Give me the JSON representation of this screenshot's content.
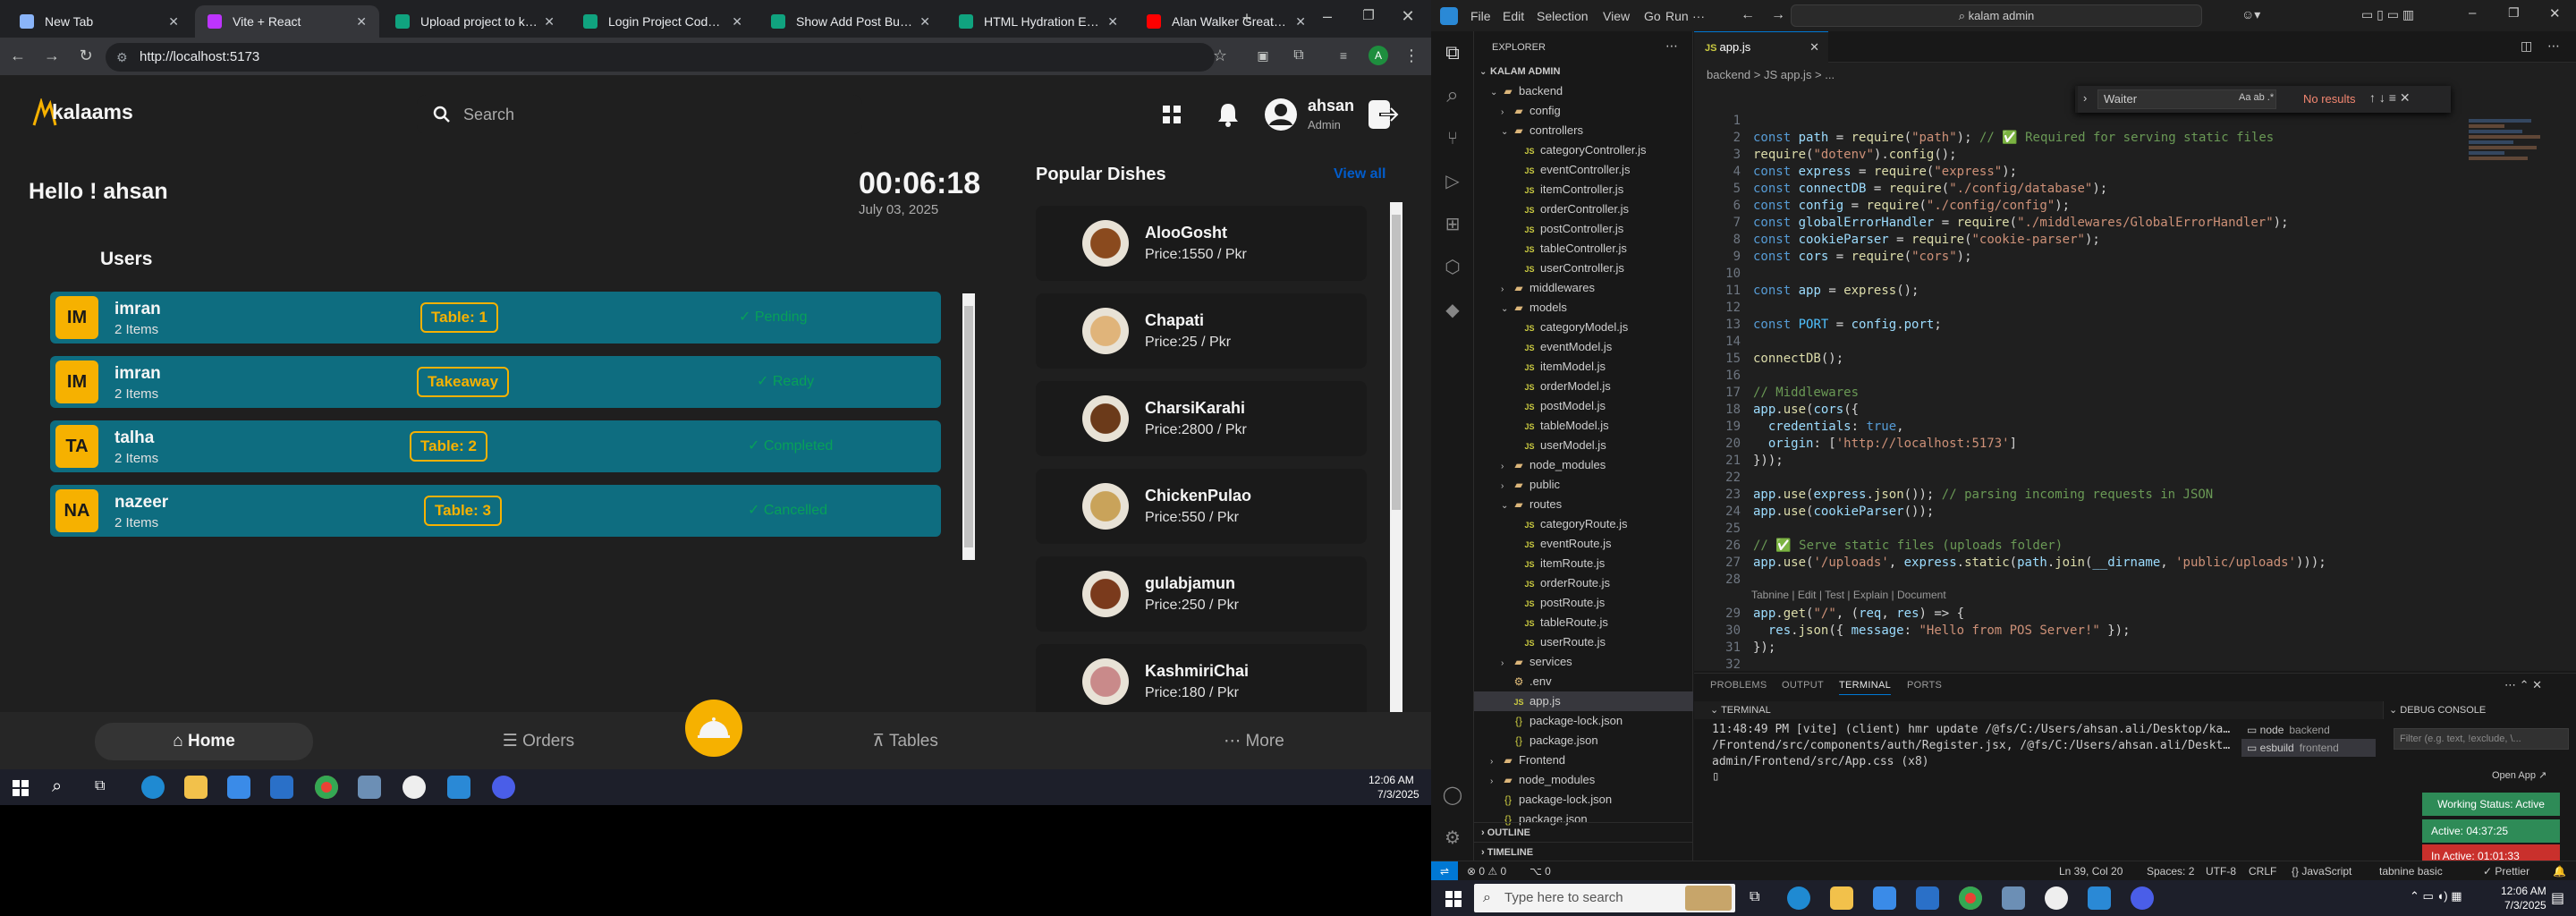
{
  "browser": {
    "tabs": [
      {
        "title": "New Tab",
        "color": "#8ab4f8",
        "active": false
      },
      {
        "title": "Vite + React",
        "color": "#bd34fe",
        "active": true
      },
      {
        "title": "Upload project to kala",
        "color": "#10a37f",
        "active": false
      },
      {
        "title": "Login Project Code He",
        "color": "#10a37f",
        "active": false
      },
      {
        "title": "Show Add Post Button",
        "color": "#10a37f",
        "active": false
      },
      {
        "title": "HTML Hydration Error",
        "color": "#10a37f",
        "active": false
      },
      {
        "title": "Alan Walker Greatest",
        "color": "#ff0000",
        "active": false
      }
    ],
    "url": "http://localhost:5173",
    "profile_initial": "A"
  },
  "pos": {
    "brand": "kalaams",
    "search_placeholder": "Search",
    "user_name": "ahsan",
    "user_role": "Admin",
    "greeting": "Hello ! ahsan",
    "clock": "00:06:18",
    "date": "July 03, 2025",
    "users_heading": "Users",
    "orders": [
      {
        "initials": "IM",
        "name": "imran",
        "items": "2 Items",
        "table": "Table: 1",
        "status": "Pending"
      },
      {
        "initials": "IM",
        "name": "imran",
        "items": "2 Items",
        "table": "Takeaway",
        "status": "Ready"
      },
      {
        "initials": "TA",
        "name": "talha",
        "items": "2 Items",
        "table": "Table: 2",
        "status": "Completed"
      },
      {
        "initials": "NA",
        "name": "nazeer",
        "items": "2 Items",
        "table": "Table: 3",
        "status": "Cancelled"
      }
    ],
    "popular_heading": "Popular Dishes",
    "view_all": "View all",
    "dishes": [
      {
        "name": "AlooGosht",
        "price": "Price:1550 / Pkr",
        "color": "#8a4a1e"
      },
      {
        "name": "Chapati",
        "price": "Price:25 / Pkr",
        "color": "#e0b47a"
      },
      {
        "name": "CharsiKarahi",
        "price": "Price:2800 / Pkr",
        "color": "#6b3a1a"
      },
      {
        "name": "ChickenPulao",
        "price": "Price:550 / Pkr",
        "color": "#c9a35a"
      },
      {
        "name": "gulabjamun",
        "price": "Price:250 / Pkr",
        "color": "#7a3a1c"
      },
      {
        "name": "KashmiriChai",
        "price": "Price:180 / Pkr",
        "color": "#c98a8a"
      }
    ],
    "nav": {
      "home": "Home",
      "orders": "Orders",
      "tables": "Tables",
      "more": "More"
    }
  },
  "left_taskbar": {
    "time": "12:06 AM",
    "date": "7/3/2025"
  },
  "vscode": {
    "menu": [
      "File",
      "Edit",
      "Selection",
      "View",
      "Go",
      "Run",
      "···"
    ],
    "command_center": "kalam admin",
    "explorer_title": "EXPLORER",
    "tree": [
      {
        "label": "KALAM ADMIN",
        "indent": 0,
        "kind": "root",
        "open": true
      },
      {
        "label": "backend",
        "indent": 1,
        "kind": "folder",
        "open": true
      },
      {
        "label": "config",
        "indent": 2,
        "kind": "folder",
        "open": false
      },
      {
        "label": "controllers",
        "indent": 2,
        "kind": "folder",
        "open": true
      },
      {
        "label": "categoryController.js",
        "indent": 3,
        "kind": "js"
      },
      {
        "label": "eventController.js",
        "indent": 3,
        "kind": "js"
      },
      {
        "label": "itemController.js",
        "indent": 3,
        "kind": "js"
      },
      {
        "label": "orderController.js",
        "indent": 3,
        "kind": "js"
      },
      {
        "label": "postController.js",
        "indent": 3,
        "kind": "js"
      },
      {
        "label": "tableController.js",
        "indent": 3,
        "kind": "js"
      },
      {
        "label": "userController.js",
        "indent": 3,
        "kind": "js"
      },
      {
        "label": "middlewares",
        "indent": 2,
        "kind": "folder",
        "open": false
      },
      {
        "label": "models",
        "indent": 2,
        "kind": "folder",
        "open": true
      },
      {
        "label": "categoryModel.js",
        "indent": 3,
        "kind": "js"
      },
      {
        "label": "eventModel.js",
        "indent": 3,
        "kind": "js"
      },
      {
        "label": "itemModel.js",
        "indent": 3,
        "kind": "js"
      },
      {
        "label": "orderModel.js",
        "indent": 3,
        "kind": "js"
      },
      {
        "label": "postModel.js",
        "indent": 3,
        "kind": "js"
      },
      {
        "label": "tableModel.js",
        "indent": 3,
        "kind": "js"
      },
      {
        "label": "userModel.js",
        "indent": 3,
        "kind": "js"
      },
      {
        "label": "node_modules",
        "indent": 2,
        "kind": "folder",
        "open": false
      },
      {
        "label": "public",
        "indent": 2,
        "kind": "folder",
        "open": false
      },
      {
        "label": "routes",
        "indent": 2,
        "kind": "folder",
        "open": true
      },
      {
        "label": "categoryRoute.js",
        "indent": 3,
        "kind": "js"
      },
      {
        "label": "eventRoute.js",
        "indent": 3,
        "kind": "js"
      },
      {
        "label": "itemRoute.js",
        "indent": 3,
        "kind": "js"
      },
      {
        "label": "orderRoute.js",
        "indent": 3,
        "kind": "js"
      },
      {
        "label": "postRoute.js",
        "indent": 3,
        "kind": "js"
      },
      {
        "label": "tableRoute.js",
        "indent": 3,
        "kind": "js"
      },
      {
        "label": "userRoute.js",
        "indent": 3,
        "kind": "js"
      },
      {
        "label": "services",
        "indent": 2,
        "kind": "folder",
        "open": false
      },
      {
        "label": ".env",
        "indent": 2,
        "kind": "env"
      },
      {
        "label": "app.js",
        "indent": 2,
        "kind": "js",
        "selected": true
      },
      {
        "label": "package-lock.json",
        "indent": 2,
        "kind": "json"
      },
      {
        "label": "package.json",
        "indent": 2,
        "kind": "json"
      },
      {
        "label": "Frontend",
        "indent": 1,
        "kind": "folder",
        "open": false
      },
      {
        "label": "node_modules",
        "indent": 1,
        "kind": "folder",
        "open": false
      },
      {
        "label": "package-lock.json",
        "indent": 1,
        "kind": "json"
      },
      {
        "label": "package.json",
        "indent": 1,
        "kind": "json"
      }
    ],
    "outline": "OUTLINE",
    "timeline": "TIMELINE",
    "editor_tab": "app.js",
    "breadcrumb": "backend  >  JS app.js  >  ...",
    "find_value": "Waiter",
    "find_result": "No results",
    "codelens": "Tabnine | Edit | Test | Explain | Document",
    "code": [
      "",
      "const path = require(\"path\"); // ✅ Required for serving static files",
      "require(\"dotenv\").config();",
      "const express = require(\"express\");",
      "const connectDB = require(\"./config/database\");",
      "const config = require(\"./config/config\");",
      "const globalErrorHandler = require(\"./middlewares/GlobalErrorHandler\");",
      "const cookieParser = require(\"cookie-parser\");",
      "const cors = require(\"cors\");",
      "",
      "const app = express();",
      "",
      "const PORT = config.port;",
      "",
      "connectDB();",
      "",
      "// Middlewares",
      "app.use(cors({",
      "  credentials: true,",
      "  origin: ['http://localhost:5173']",
      "}));",
      "",
      "app.use(express.json()); // parsing incoming requests in JSON",
      "app.use(cookieParser());",
      "",
      "// ✅ Serve static files (uploads folder)",
      "app.use('/uploads', express.static(path.join(__dirname, 'public/uploads')));",
      "",
      "app.get(\"/\", (req, res) => {",
      "  res.json({ message: \"Hello from POS Server!\" });",
      "});",
      ""
    ],
    "panel_tabs": [
      "PROBLEMS",
      "OUTPUT",
      "TERMINAL",
      "PORTS"
    ],
    "terminal_title": "TERMINAL",
    "terminal_lines": [
      "11:48:49 PM [vite] (client) hmr update /@fs/C:/Users/ahsan.ali/Desktop/kalam admin",
      "/Frontend/src/components/auth/Register.jsx, /@fs/C:/Users/ahsan.ali/Desktop/kalam",
      "admin/Frontend/src/App.css (x8)"
    ],
    "terminals": [
      {
        "name": "node",
        "label": "backend"
      },
      {
        "name": "esbuild",
        "label": "frontend"
      }
    ],
    "debug_title": "DEBUG CONSOLE",
    "debug_filter": "Filter (e.g. text, !exclude, \\...",
    "open_app": "Open App ↗",
    "working_status": "Working Status: Active",
    "active_time": "Active: 04:37:25",
    "inactive_time": "In Active: 01:01:33",
    "status": {
      "errors": "⊗ 0  ⚠ 0",
      "ports": "⌥ 0",
      "position": "Ln 39, Col 20",
      "spaces": "Spaces: 2",
      "encoding": "UTF-8",
      "eol": "CRLF",
      "language": "{} JavaScript",
      "tabnine": "tabnine basic",
      "prettier": "✓ Prettier"
    }
  },
  "right_taskbar": {
    "search_placeholder": "Type here to search",
    "time": "12:06 AM",
    "date": "7/3/2025"
  }
}
